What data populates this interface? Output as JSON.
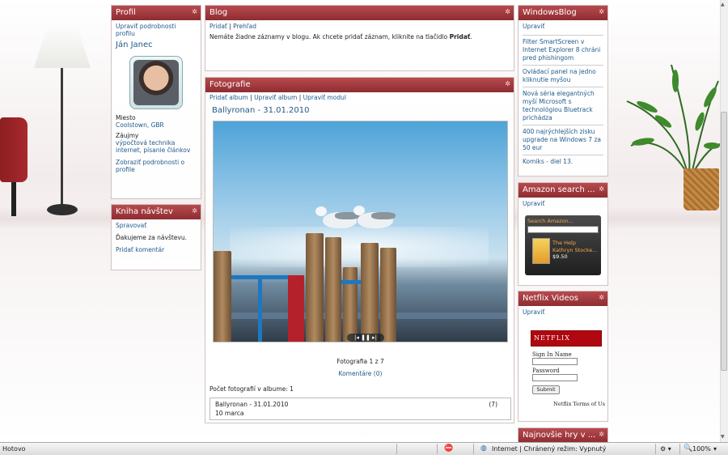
{
  "profile": {
    "title": "Profil",
    "edit_link": "Upraviť podrobnosti profilu",
    "name": "Ján Janec",
    "city_label": "Miesto",
    "city_value": "Coolstown, GBR",
    "interests_label": "Záujmy",
    "interests_value": "výpočtová technika internet, písanie článkov",
    "more_link": "Zobraziť podrobnosti o profile"
  },
  "guestbook": {
    "title": "Kniha návštev",
    "manage_link": "Spravovať",
    "thanks": "Ďakujeme za návštevu.",
    "add_comment": "Pridať komentár"
  },
  "blog": {
    "title": "Blog",
    "add_link": "Pridať",
    "overview_link": "Prehľad",
    "message_prefix": "Nemáte žiadne záznamy v blogu. Ak chcete pridať záznam, kliknite na tlačidlo ",
    "message_bold": "Pridať",
    "message_suffix": "."
  },
  "photos": {
    "title": "Fotografie",
    "add_album": "Pridať album",
    "edit_album": "Upraviť album",
    "edit_module": "Upraviť modul",
    "album_title": "Ballyronan - 31.01.2010",
    "counter": "Fotografia 1 z 7",
    "comments": "Komentáre (0)",
    "album_count": "Počet fotografií v albume: 1",
    "album_item_title": "Ballyronan - 31.01.2010",
    "album_item_count": "(7)",
    "album_item_date": "10 marca",
    "controls": "|◂ ❚❚ ▸|"
  },
  "windowsblog": {
    "title": "WindowsBlog",
    "edit_link": "Upraviť",
    "items": [
      "Filter SmartScreen v Internet Explorer 8 chráni pred phishingom",
      "Ovládací panel na jedno kliknutie myšou",
      "Nová séria elegantných myší Microsoft s technológiou Bluetrack prichádza",
      "400 najrýchlejších zisku upgrade na Windows 7 za 50 eur",
      "Komiks - diel 13."
    ]
  },
  "amazon": {
    "title": "Amazon search ...",
    "edit_link": "Upraviť",
    "search_label": "Search Amazon...",
    "book_title": "The Help",
    "book_author": "Kathryn Stocke...",
    "book_price": "$9.50"
  },
  "netflix": {
    "title": "Netflix Videos",
    "edit_link": "Upraviť",
    "logo": "NETFLIX",
    "sign_in_label": "Sign In Name",
    "password_label": "Password",
    "submit_label": "Submit",
    "terms": "Netflix Terms of Us"
  },
  "najnovsie": {
    "title": "Najnovšie hry v ..."
  },
  "statusbar": {
    "left": "Hotovo",
    "zone": "Internet | Chránený režim: Vypnutý",
    "zoom": "100%"
  }
}
